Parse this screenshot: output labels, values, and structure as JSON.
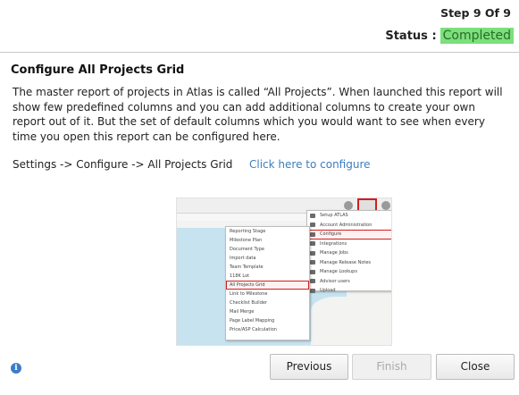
{
  "header": {
    "step": "Step 9 Of 9",
    "status_label": "Status :",
    "status_value": "Completed",
    "status_color": "#7be07b"
  },
  "content": {
    "title": "Configure All Projects Grid",
    "description": "The master report of projects in Atlas is called “All Projects”. When launched this report will show few predefined columns and you can add additional columns to create your own report out of it. But the set of default columns which you would want to see when every time you open this report can be configured here.",
    "nav_path": "Settings -> Configure -> All Projects Grid",
    "link_text": "Click here to configure",
    "link_color": "#3a7fbf"
  },
  "screenshot": {
    "left_menu": [
      "Reporting Stage",
      "Milestone Plan",
      "Document Type",
      "Import data",
      "Team Template",
      "118K Lot",
      "All Projects Grid",
      "Link to Milestone",
      "Checklist Builder",
      "Mail Merge",
      "Page Label Mapping",
      "Price/ASP Calculation"
    ],
    "left_menu_highlight_index": 6,
    "right_menu": [
      "Setup ATLAS",
      "Account Administration",
      "Configure",
      "Integrations",
      "Manage Jobs",
      "Manage Release Notes",
      "Manage Lookups",
      "Advisor users",
      "Upload"
    ],
    "right_menu_highlight_index": 2,
    "highlight_color": "#d21e1e"
  },
  "footer": {
    "info_icon": "i",
    "previous_label": "Previous",
    "finish_label": "Finish",
    "close_label": "Close"
  }
}
